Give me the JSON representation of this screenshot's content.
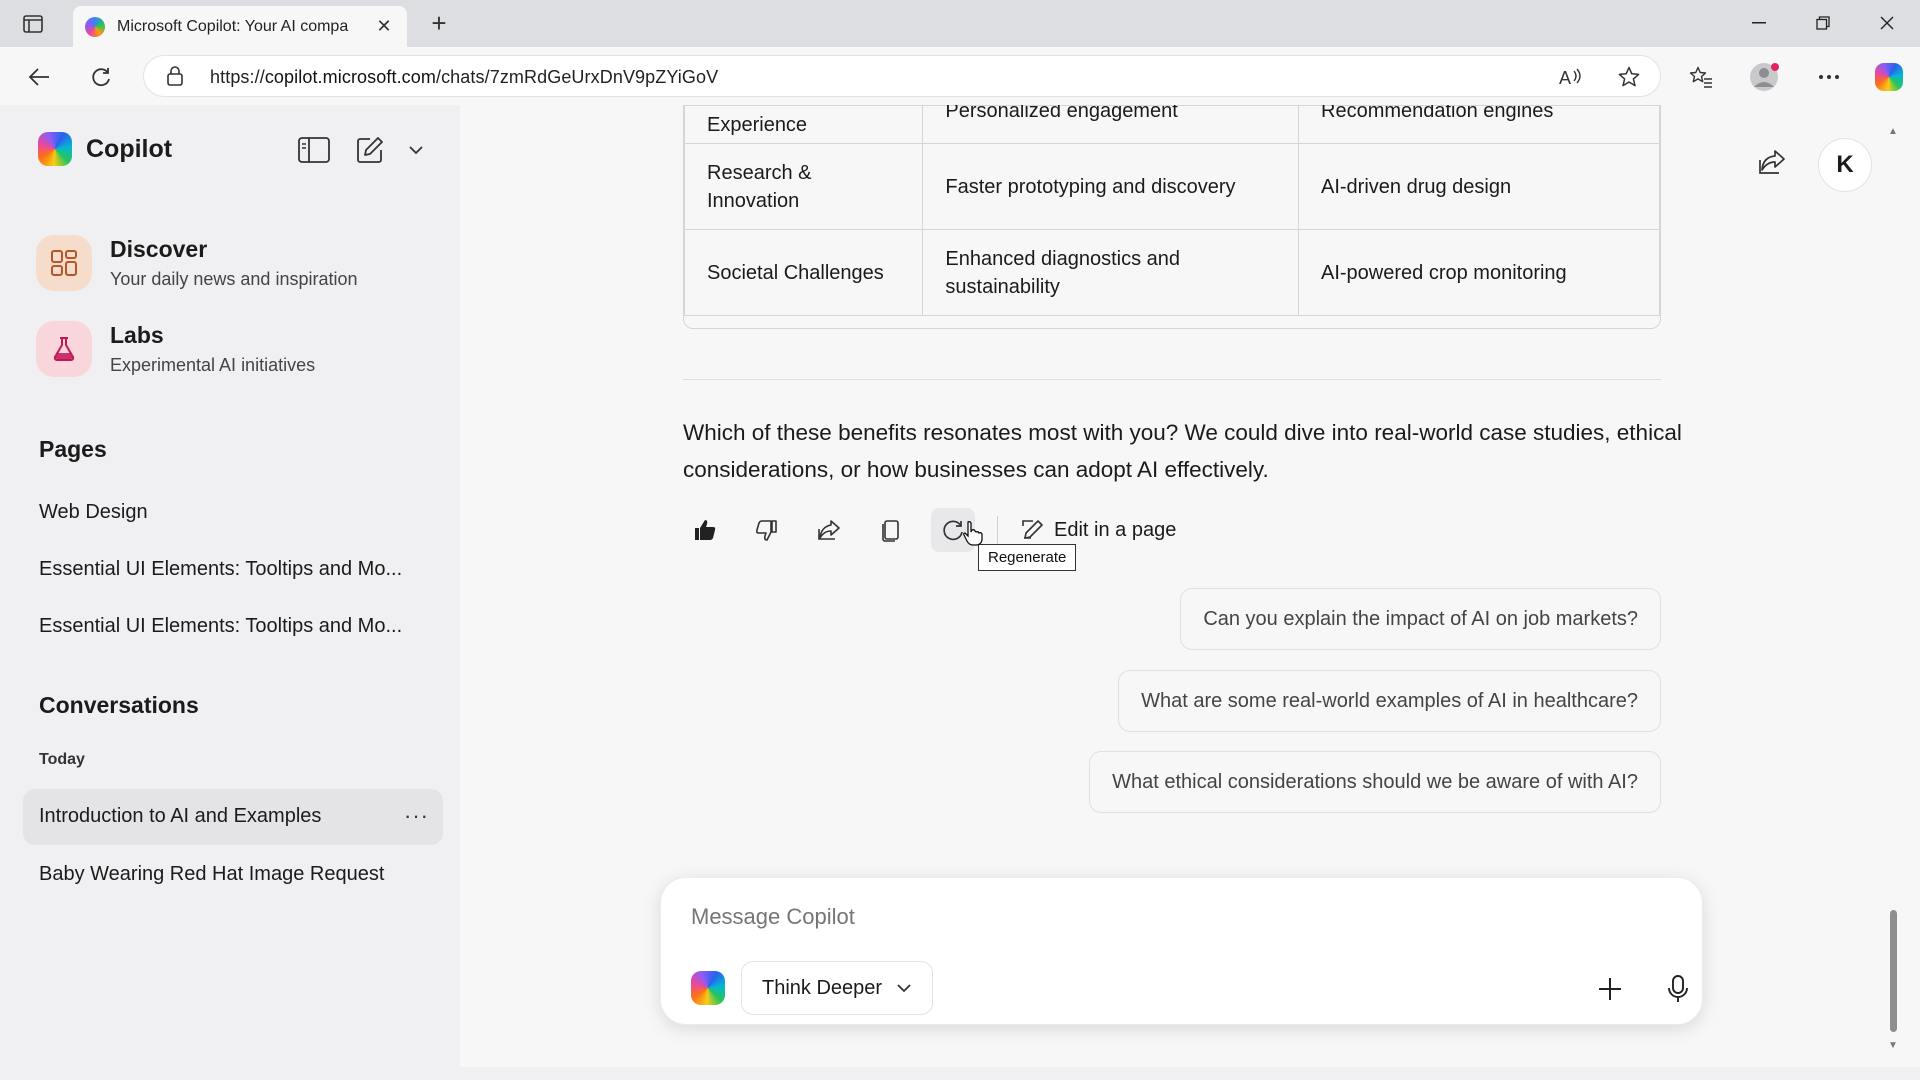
{
  "browser": {
    "tab_title": "Microsoft Copilot: Your AI compa",
    "url_prefix": "https://",
    "url_host": "copilot.microsoft.com",
    "url_path": "/chats/7zmRdGeUrxDnV9pZYiGoV"
  },
  "sidebar": {
    "brand": "Copilot",
    "nav": [
      {
        "title": "Discover",
        "subtitle": "Your daily news and inspiration"
      },
      {
        "title": "Labs",
        "subtitle": "Experimental AI initiatives"
      }
    ],
    "pages_heading": "Pages",
    "pages": [
      "Web Design",
      "Essential UI Elements: Tooltips and Mo...",
      "Essential UI Elements: Tooltips and Mo..."
    ],
    "conversations_heading": "Conversations",
    "today_label": "Today",
    "conversations": [
      "Introduction to AI and Examples",
      "Baby Wearing Red Hat Image Request"
    ],
    "more_label": "···"
  },
  "table": {
    "rows": [
      [
        "Experience",
        "Personalized engagement",
        "Recommendation engines"
      ],
      [
        "Research & Innovation",
        "Faster prototyping and discovery",
        "AI-driven drug design"
      ],
      [
        "Societal Challenges",
        "Enhanced diagnostics and sustainability",
        "AI-powered crop monitoring"
      ]
    ]
  },
  "response_text": "Which of these benefits resonates most with you? We could dive into real-world case studies, ethical considerations, or how businesses can adopt AI effectively.",
  "actions": {
    "edit_label": "Edit in a page",
    "tooltip": "Regenerate"
  },
  "suggestions": [
    "Can you explain the impact of AI on job markets?",
    "What are some real-world examples of AI in healthcare?",
    "What ethical considerations should we be aware of with AI?"
  ],
  "composer": {
    "placeholder": "Message Copilot",
    "mode": "Think Deeper"
  },
  "user_initial": "K",
  "colors": {
    "discover_bg": "#f6dccb",
    "labs_bg": "#f9d6dc",
    "active_conversation_bg": "#e4e4e7"
  }
}
